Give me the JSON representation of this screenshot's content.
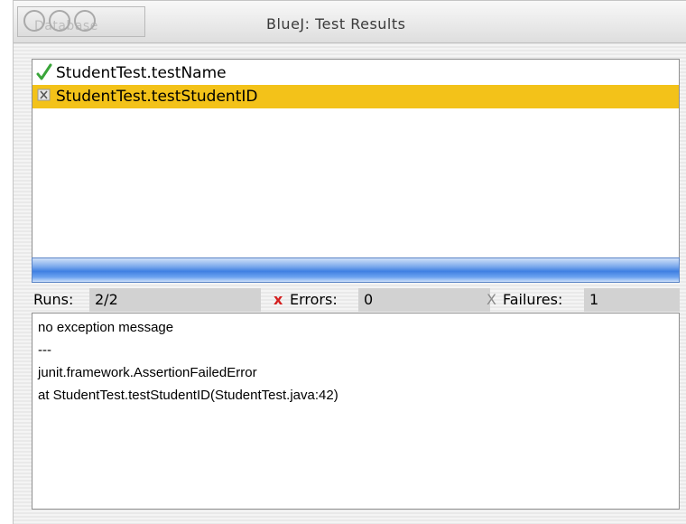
{
  "window": {
    "title": "BlueJ:  Test Results",
    "ghost_label": "Database"
  },
  "tests": [
    {
      "name": "StudentTest.testName",
      "status": "passed",
      "icon": "check-icon",
      "selected": false
    },
    {
      "name": "StudentTest.testStudentID",
      "status": "failed",
      "icon": "failure-x-icon",
      "selected": true
    }
  ],
  "progress": {
    "fraction": 1.0,
    "color": "#3f7fe2"
  },
  "stats": {
    "runs_label": "Runs:",
    "runs_value": "2/2",
    "errors_icon": "x",
    "errors_label": "Errors:",
    "errors_value": "0",
    "failures_icon": "X",
    "failures_label": "Failures:",
    "failures_value": "1"
  },
  "message": {
    "lines": [
      "no exception message",
      "---",
      "junit.framework.AssertionFailedError",
      " at StudentTest.testStudentID(StudentTest.java:42)"
    ]
  },
  "colors": {
    "selection": "#f3c219",
    "error_red": "#d41f1f",
    "pass_green": "#3aa53a"
  }
}
